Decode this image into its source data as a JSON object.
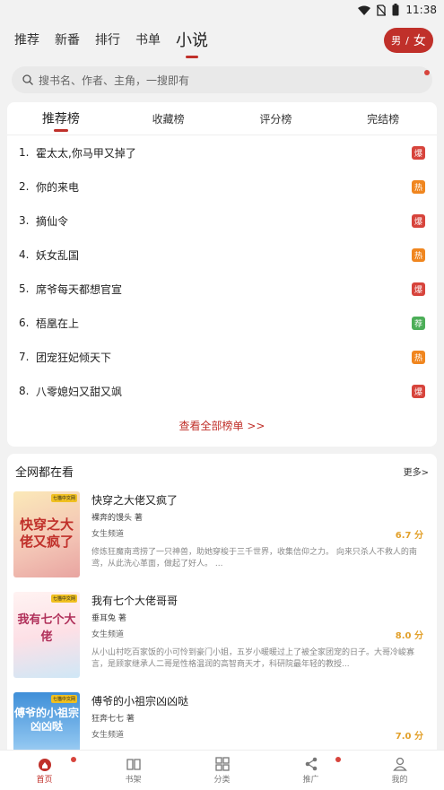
{
  "status": {
    "time": "11:38"
  },
  "top_nav": {
    "tabs": [
      "推荐",
      "新番",
      "排行",
      "书单",
      "小说"
    ],
    "active": 4,
    "gender": {
      "male": "男",
      "sep": "/",
      "female": "女"
    }
  },
  "search": {
    "placeholder": "搜书名、作者、主角，一搜即有"
  },
  "ranking": {
    "tabs": [
      "推荐榜",
      "收藏榜",
      "评分榜",
      "完结榜"
    ],
    "active": 0,
    "items": [
      {
        "num": "1.",
        "title": "霍太太,你马甲又掉了",
        "badge": "爆",
        "badge_color": "#d7443c"
      },
      {
        "num": "2.",
        "title": "你的来电",
        "badge": "热",
        "badge_color": "#f0861f"
      },
      {
        "num": "3.",
        "title": "摘仙令",
        "badge": "爆",
        "badge_color": "#d7443c"
      },
      {
        "num": "4.",
        "title": "妖女乱国",
        "badge": "热",
        "badge_color": "#f0861f"
      },
      {
        "num": "5.",
        "title": "席爷每天都想官宣",
        "badge": "爆",
        "badge_color": "#d7443c"
      },
      {
        "num": "6.",
        "title": "梧凰在上",
        "badge": "荐",
        "badge_color": "#4cae58"
      },
      {
        "num": "7.",
        "title": "团宠狂妃倾天下",
        "badge": "热",
        "badge_color": "#f0861f"
      },
      {
        "num": "8.",
        "title": "八零媳妇又甜又飒",
        "badge": "爆",
        "badge_color": "#d7443c"
      }
    ],
    "view_all": "查看全部榜单 >>"
  },
  "popular": {
    "title": "全网都在看",
    "more": "更多>",
    "books": [
      {
        "name": "快穿之大佬又疯了",
        "author": "裸奔的馒头 著",
        "channel": "女生频道",
        "score": "6.7 分",
        "desc": "修炼狂魔南鸢捞了一只神兽，助她穿梭于三千世界，收集信仰之力。 向来只杀人不救人的南鸢，从此洗心革面，做起了好人。 ...",
        "cover_text": "快穿之大佬又疯了",
        "cover_tag": "七猫中文网"
      },
      {
        "name": "我有七个大佬哥哥",
        "author": "垂耳兔 著",
        "channel": "女生频道",
        "score": "8.0 分",
        "desc": "从小山村吃百家饭的小可怜到豪门小姐，五岁小暖暖过上了被全家团宠的日子。大哥冷峻寡言，是顾家继承人二哥是性格温润的高智商天才，科研院最年轻的教授...",
        "cover_text": "我有七个大佬",
        "cover_tag": "七猫中文网"
      },
      {
        "name": "傅爷的小祖宗凶凶哒",
        "author": "狂奔七七 著",
        "channel": "女生频道",
        "score": "7.0 分",
        "desc": "",
        "cover_text": "傅爷的小祖宗凶凶哒",
        "cover_tag": "七猫中文网"
      }
    ]
  },
  "bottom_nav": {
    "items": [
      {
        "label": "首页",
        "icon": "home-icon"
      },
      {
        "label": "书架",
        "icon": "bookshelf-icon"
      },
      {
        "label": "分类",
        "icon": "category-icon"
      },
      {
        "label": "推广",
        "icon": "share-icon"
      },
      {
        "label": "我的",
        "icon": "profile-icon"
      }
    ],
    "active": 0
  }
}
